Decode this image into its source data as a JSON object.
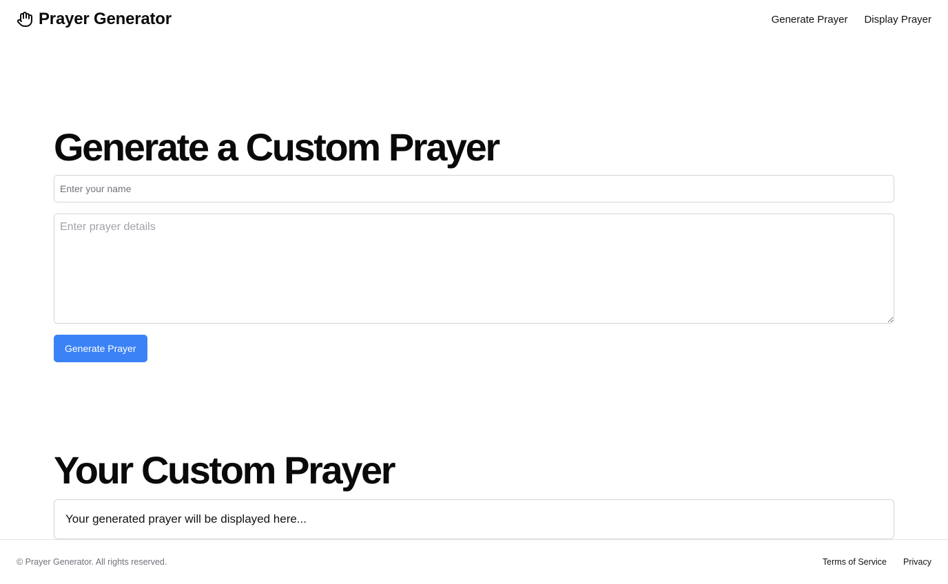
{
  "header": {
    "brand_title": "Prayer Generator",
    "brand_icon": "hand-icon",
    "nav": [
      {
        "label": "Generate Prayer"
      },
      {
        "label": "Display Prayer"
      }
    ]
  },
  "generate_section": {
    "title": "Generate a Custom Prayer",
    "name_placeholder": "Enter your name",
    "name_value": "",
    "details_placeholder": "Enter prayer details",
    "details_value": "",
    "button_label": "Generate Prayer"
  },
  "result_section": {
    "title": "Your Custom Prayer",
    "placeholder_text": "Your generated prayer will be displayed here..."
  },
  "footer": {
    "copyright": "© Prayer Generator. All rights reserved.",
    "links": [
      {
        "label": "Terms of Service"
      },
      {
        "label": "Privacy"
      }
    ]
  },
  "colors": {
    "accent": "#3b82f6",
    "text": "#0a0a0a",
    "muted": "#71717a",
    "border": "#d4d4d8"
  }
}
